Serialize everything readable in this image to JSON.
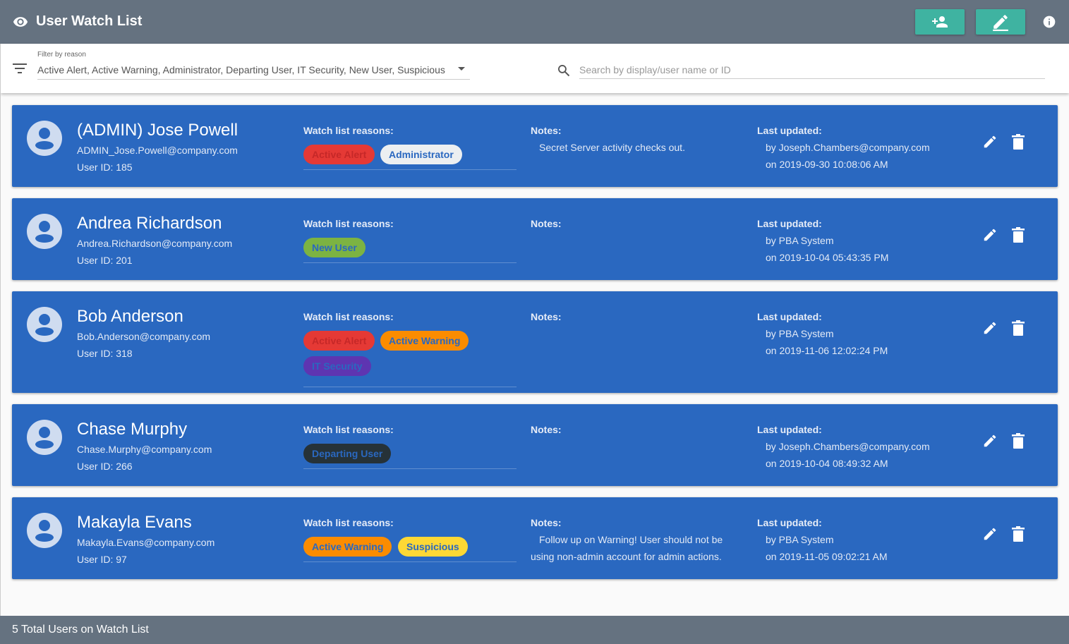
{
  "header": {
    "title": "User Watch List",
    "icons": [
      "eye-icon",
      "add-user-icon",
      "edit-icon",
      "info-icon"
    ]
  },
  "filter": {
    "caption": "Filter by reason",
    "value": "Active Alert, Active Warning, Administrator, Departing User, IT Security, New User, Suspicious"
  },
  "search": {
    "placeholder": "Search by display/user name or ID"
  },
  "labels": {
    "reasons": "Watch list reasons:",
    "notes": "Notes:",
    "updated": "Last updated:"
  },
  "colors": {
    "header_bg": "#657280",
    "card_bg": "#2a68c0",
    "accent_button": "#3fb3a1",
    "chip_active_alert": "#e53935",
    "chip_active_warning": "#fb8c00",
    "chip_administrator": "#eceff1",
    "chip_new_user": "#7cb342",
    "chip_it_security": "#5e35b1",
    "chip_departing_user": "#263238",
    "chip_suspicious": "#fdd835"
  },
  "users": [
    {
      "name": "(ADMIN) Jose Powell",
      "email": "ADMIN_Jose.Powell@company.com",
      "user_id": "User ID: 185",
      "reasons": [
        "Active Alert",
        "Administrator"
      ],
      "notes": [
        "Secret Server activity checks out."
      ],
      "updated_by": "by Joseph.Chambers@company.com",
      "updated_on": "on 2019-09-30 10:08:06 AM"
    },
    {
      "name": "Andrea Richardson",
      "email": "Andrea.Richardson@company.com",
      "user_id": "User ID: 201",
      "reasons": [
        "New User"
      ],
      "notes": [],
      "updated_by": "by PBA System",
      "updated_on": "on 2019-10-04 05:43:35 PM"
    },
    {
      "name": "Bob Anderson",
      "email": "Bob.Anderson@company.com",
      "user_id": "User ID: 318",
      "reasons": [
        "Active Alert",
        "Active Warning",
        "IT Security"
      ],
      "notes": [],
      "updated_by": "by PBA System",
      "updated_on": "on 2019-11-06 12:02:24 PM"
    },
    {
      "name": "Chase Murphy",
      "email": "Chase.Murphy@company.com",
      "user_id": "User ID: 266",
      "reasons": [
        "Departing User"
      ],
      "notes": [],
      "updated_by": "by Joseph.Chambers@company.com",
      "updated_on": "on 2019-10-04 08:49:32 AM"
    },
    {
      "name": "Makayla Evans",
      "email": "Makayla.Evans@company.com",
      "user_id": "User ID: 97",
      "reasons": [
        "Active Warning",
        "Suspicious"
      ],
      "notes": [
        "Follow up on Warning! User should not be",
        "using non-admin account for admin actions."
      ],
      "updated_by": "by PBA System",
      "updated_on": "on 2019-11-05 09:02:21 AM"
    }
  ],
  "footer": {
    "total": "5 Total Users on Watch List"
  }
}
